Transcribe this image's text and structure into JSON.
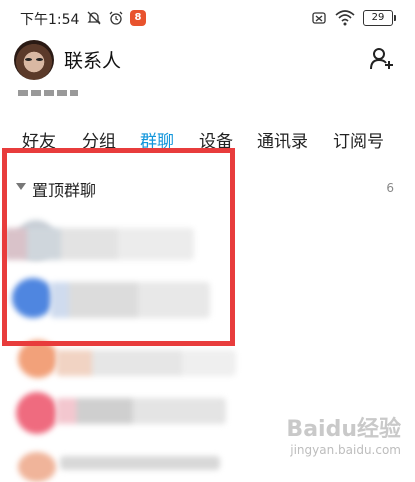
{
  "status_bar": {
    "time": "下午1:54",
    "app_badge_text": "8",
    "battery": "29"
  },
  "header": {
    "title": "联系人"
  },
  "tabs": [
    {
      "label": "好友"
    },
    {
      "label": "分组"
    },
    {
      "label": "群聊",
      "active": true
    },
    {
      "label": "设备"
    },
    {
      "label": "通讯录"
    },
    {
      "label": "订阅号"
    }
  ],
  "section": {
    "label": "置顶群聊",
    "count": "6"
  },
  "watermark": {
    "brand": "Baidu经验",
    "url": "jingyan.baidu.com"
  },
  "colors": {
    "active_tab": "#1296db",
    "highlight_box": "#e83c3c"
  }
}
